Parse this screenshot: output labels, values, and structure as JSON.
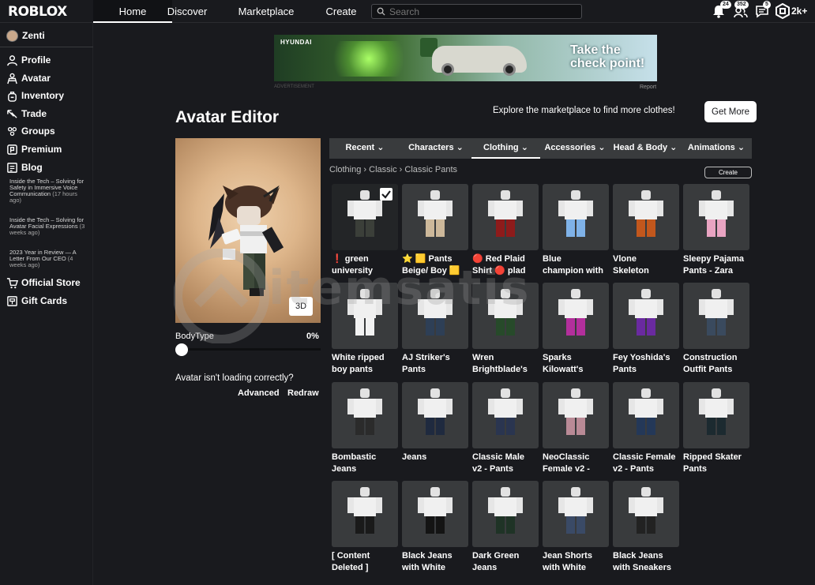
{
  "topnav": {
    "logo": "ROBLOX",
    "tabs": [
      {
        "label": "Home"
      },
      {
        "label": "Discover"
      },
      {
        "label": "Marketplace"
      },
      {
        "label": "Create"
      }
    ],
    "search_placeholder": "Search",
    "notifications_badge": "24",
    "friends_badge": "352",
    "messages_badge": "5",
    "robux": "2k+"
  },
  "sidebar": {
    "username": "Zenti",
    "items": [
      {
        "label": "Profile"
      },
      {
        "label": "Avatar"
      },
      {
        "label": "Inventory"
      },
      {
        "label": "Trade"
      },
      {
        "label": "Groups"
      },
      {
        "label": "Premium"
      },
      {
        "label": "Blog"
      }
    ],
    "blog_posts": [
      {
        "title": "Inside the Tech – Solving for Safety in Immersive Voice Communication",
        "ago": "(17 hours ago)"
      },
      {
        "title": "Inside the Tech – Solving for Avatar Facial Expressions",
        "ago": "(3 weeks ago)"
      },
      {
        "title": "2023 Year in Review — A Letter From Our CEO",
        "ago": "(4 weeks ago)"
      }
    ],
    "official_store": "Official Store",
    "gift_cards": "Gift Cards"
  },
  "ad": {
    "brand": "HYUNDAI",
    "headline": "Take the check point!",
    "label": "ADVERTISEMENT",
    "report": "Report"
  },
  "header": {
    "title": "Avatar Editor",
    "explore_text": "Explore the marketplace to find more clothes!",
    "get_more": "Get More"
  },
  "preview": {
    "btn_3d": "3D",
    "bodytype_label": "BodyType",
    "bodytype_value": "0%",
    "bodytype_fraction": 0,
    "loading_question": "Avatar isn't loading correctly?",
    "advanced": "Advanced",
    "redraw": "Redraw"
  },
  "categories": [
    {
      "label": "Recent"
    },
    {
      "label": "Characters"
    },
    {
      "label": "Clothing"
    },
    {
      "label": "Accessories"
    },
    {
      "label": "Head & Body"
    },
    {
      "label": "Animations"
    }
  ],
  "breadcrumb": {
    "a": "Clothing",
    "b": "Classic",
    "c": "Classic Pants"
  },
  "create_label": "Create",
  "items": [
    {
      "l1": "❗ green",
      "l2": "university",
      "pants": "#3b3f39",
      "selected": true
    },
    {
      "l1": "⭐ 🟨 Pants",
      "l2": "Beige/ Boy 🟨",
      "pants": "#cdb89a"
    },
    {
      "l1": "🔴 Red Plaid",
      "l2": "Shirt 🔴 plad",
      "pants": "#8e1b1b"
    },
    {
      "l1": "Blue",
      "l2": "champion with",
      "pants": "#7fb2e8"
    },
    {
      "l1": "Vlone",
      "l2": "Skeleton",
      "pants": "#c2571d"
    },
    {
      "l1": "Sleepy Pajama",
      "l2": "Pants - Zara",
      "pants": "#e9a4c2"
    },
    {
      "l1": "White ripped",
      "l2": "boy pants",
      "pants": "#f2f2f2"
    },
    {
      "l1": "AJ Striker's",
      "l2": "Pants",
      "pants": "#2e3f56"
    },
    {
      "l1": "Wren",
      "l2": "Brightblade's",
      "pants": "#274a2a"
    },
    {
      "l1": "Sparks",
      "l2": "Kilowatt's",
      "pants": "#b32f9c"
    },
    {
      "l1": "Fey Yoshida's",
      "l2": "Pants",
      "pants": "#6a2aa0"
    },
    {
      "l1": "Construction",
      "l2": "Outfit Pants",
      "pants": "#3a4a5e"
    },
    {
      "l1": "Bombastic",
      "l2": "Jeans",
      "pants": "#2b2b2b"
    },
    {
      "l1": "Jeans",
      "l2": "",
      "pants": "#1f2a3f"
    },
    {
      "l1": "Classic Male",
      "l2": "v2 - Pants",
      "pants": "#2a3550"
    },
    {
      "l1": "NeoClassic",
      "l2": "Female v2 -",
      "pants": "#b98a96"
    },
    {
      "l1": "Classic Female",
      "l2": "v2 - Pants",
      "pants": "#243858"
    },
    {
      "l1": "Ripped Skater",
      "l2": "Pants",
      "pants": "#1c2a30"
    },
    {
      "l1": "[ Content",
      "l2": "Deleted ]",
      "pants": "#1a1a1a"
    },
    {
      "l1": "Black Jeans",
      "l2": "with White",
      "pants": "#141414"
    },
    {
      "l1": "Dark Green",
      "l2": "Jeans",
      "pants": "#1f3326"
    },
    {
      "l1": "Jean Shorts",
      "l2": "with White",
      "pants": "#3a4a66"
    },
    {
      "l1": "Black Jeans",
      "l2": "with Sneakers",
      "pants": "#222"
    }
  ],
  "watermark": "itemsatis"
}
